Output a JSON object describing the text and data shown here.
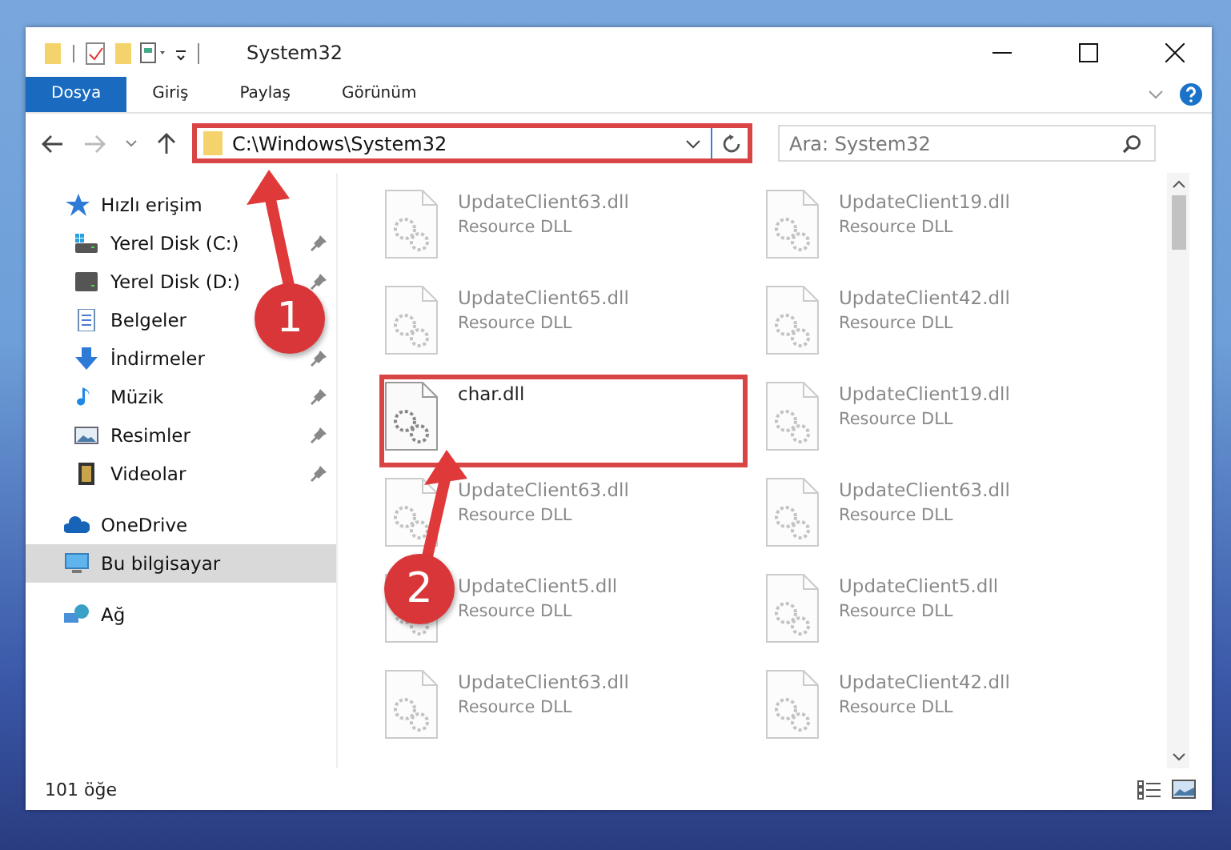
{
  "window": {
    "title": "System32"
  },
  "ribbon_tabs": [
    {
      "label": "Dosya",
      "selected": true
    },
    {
      "label": "Giriş",
      "selected": false
    },
    {
      "label": "Paylaş",
      "selected": false
    },
    {
      "label": "Görünüm",
      "selected": false
    }
  ],
  "address_bar": {
    "value": "C:\\Windows\\System32",
    "highlighted": true
  },
  "search": {
    "placeholder": "Ara: System32"
  },
  "sidebar": {
    "items": [
      {
        "label": "Hızlı erişim",
        "kind": "star",
        "selected": false,
        "children": [
          {
            "label": "Yerel Disk (C:)",
            "kind": "drive-c",
            "pinned": true
          },
          {
            "label": "Yerel Disk (D:)",
            "kind": "drive",
            "pinned": true
          },
          {
            "label": "Belgeler",
            "kind": "docs",
            "pinned": false
          },
          {
            "label": "İndirmeler",
            "kind": "download",
            "pinned": true
          },
          {
            "label": "Müzik",
            "kind": "music",
            "pinned": true
          },
          {
            "label": "Resimler",
            "kind": "pictures",
            "pinned": true
          },
          {
            "label": "Videolar",
            "kind": "videos",
            "pinned": true
          }
        ]
      },
      {
        "label": "OneDrive",
        "kind": "cloud",
        "selected": false
      },
      {
        "label": "Bu bilgisayar",
        "kind": "pc",
        "selected": true
      },
      {
        "label": "Ağ",
        "kind": "network",
        "selected": false
      }
    ]
  },
  "files": [
    {
      "name": "UpdateClient63.dll",
      "type": "Resource DLL",
      "blurred": true,
      "highlighted": false
    },
    {
      "name": "UpdateClient19.dll",
      "type": "Resource DLL",
      "blurred": true,
      "highlighted": false
    },
    {
      "name": "UpdateClient65.dll",
      "type": "Resource DLL",
      "blurred": true,
      "highlighted": false
    },
    {
      "name": "UpdateClient42.dll",
      "type": "Resource DLL",
      "blurred": true,
      "highlighted": false
    },
    {
      "name": "char.dll",
      "blurred": false,
      "highlighted": true
    },
    {
      "name": "UpdateClient19.dll",
      "type": "Resource DLL",
      "blurred": true,
      "highlighted": false
    },
    {
      "name": "UpdateClient63.dll",
      "type": "Resource DLL",
      "blurred": true,
      "highlighted": false
    },
    {
      "name": "UpdateClient63.dll",
      "type": "Resource DLL",
      "blurred": true,
      "highlighted": false
    },
    {
      "name": "UpdateClient5.dll",
      "type": "Resource DLL",
      "blurred": true,
      "highlighted": false
    },
    {
      "name": "UpdateClient5.dll",
      "type": "Resource DLL",
      "blurred": true,
      "highlighted": false
    },
    {
      "name": "UpdateClient63.dll",
      "type": "Resource DLL",
      "blurred": true,
      "highlighted": false
    },
    {
      "name": "UpdateClient42.dll",
      "type": "Resource DLL",
      "blurred": true,
      "highlighted": false
    }
  ],
  "status_bar": {
    "count": "101 öğe"
  },
  "annotations": [
    {
      "number": "1"
    },
    {
      "number": "2"
    }
  ]
}
